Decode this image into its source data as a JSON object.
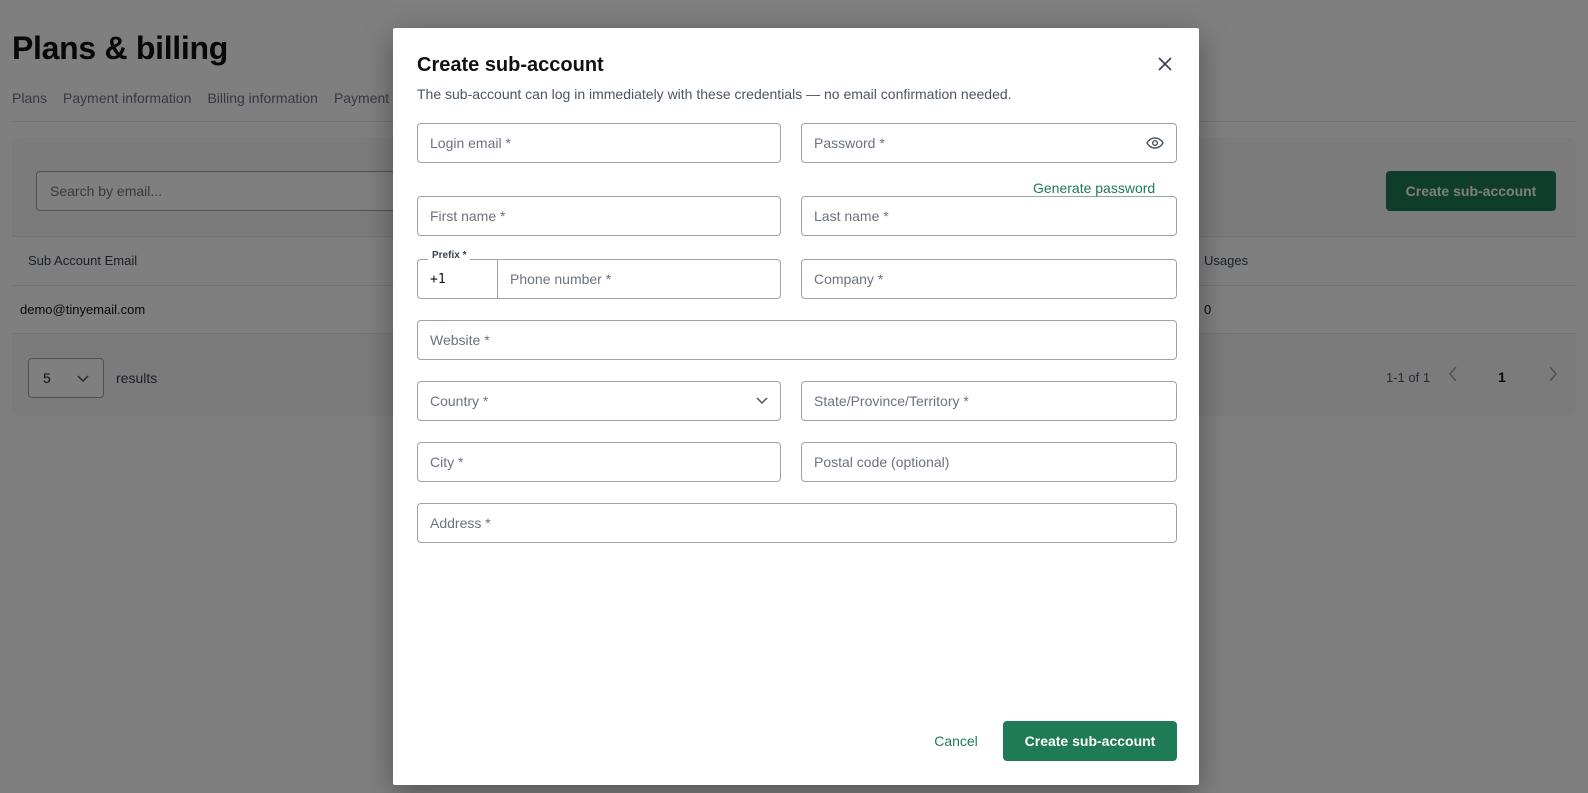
{
  "page": {
    "title": "Plans & billing",
    "tabs": [
      "Plans",
      "Payment information",
      "Billing information",
      "Payment"
    ],
    "search_placeholder": "Search by email...",
    "create_button": "Create sub-account",
    "table": {
      "columns": [
        "Sub Account Email",
        "Usages"
      ],
      "rows": [
        {
          "email": "demo@tinyemail.com",
          "usages": "0"
        }
      ]
    },
    "pagination": {
      "page_size": "5",
      "results_label": "results",
      "range": "1-1 of 1",
      "current_page": "1"
    }
  },
  "modal": {
    "title": "Create sub-account",
    "subtitle": "The sub-account can log in immediately with these credentials — no email confirmation needed.",
    "fields": {
      "login_email": "Login email *",
      "password": "Password *",
      "generate_password": "Generate password",
      "first_name": "First name *",
      "last_name": "Last name *",
      "prefix_label": "Prefix *",
      "prefix_value": "+1",
      "phone": "Phone number *",
      "company": "Company *",
      "website": "Website *",
      "country": "Country *",
      "state": "State/Province/Territory *",
      "city": "City *",
      "postal": "Postal code (optional)",
      "address": "Address *"
    },
    "cancel": "Cancel",
    "submit": "Create sub-account"
  },
  "icons": {
    "close": "close-icon",
    "eye": "eye-icon",
    "chevron": "chevron-down-icon"
  },
  "colors": {
    "accent": "#1f7a56"
  }
}
